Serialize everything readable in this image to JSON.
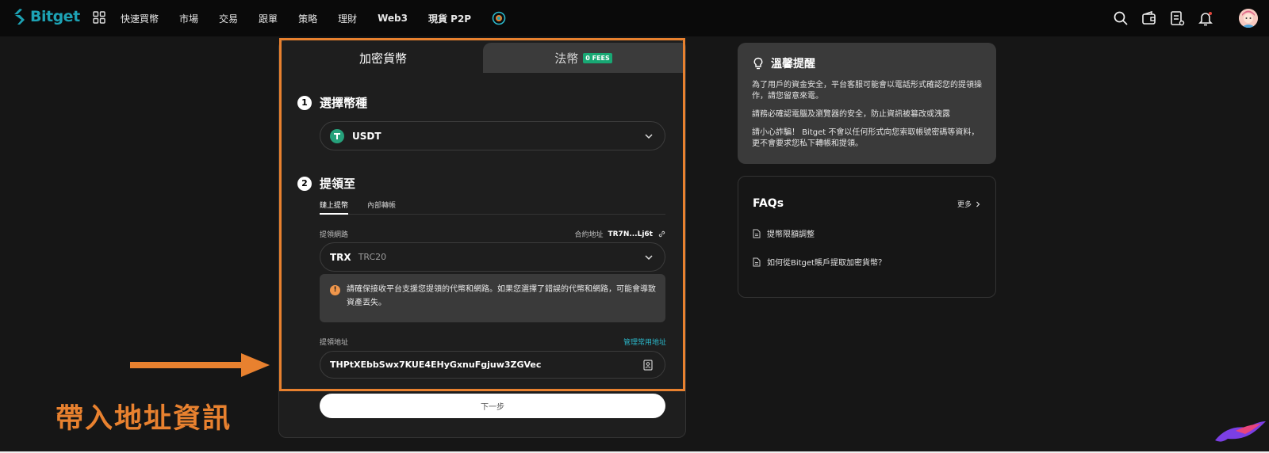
{
  "app": {
    "logo_text": "Bitget"
  },
  "nav": {
    "items": [
      "快速買幣",
      "市場",
      "交易",
      "跟單",
      "策略",
      "理財",
      "Web3",
      "現貨 P2P"
    ]
  },
  "colors": {
    "accent": "#1da2b4",
    "highlight": "#e8812f",
    "usdt": "#26a17b",
    "fees": "#18a874",
    "warning": "#f0964b"
  },
  "withdraw": {
    "tab_crypto": "加密貨幣",
    "tab_fiat": "法幣",
    "fees_badge": "0 FEES",
    "step1": {
      "num": "1",
      "title": "選擇幣種",
      "coin": "USDT",
      "coin_icon": "tether-icon"
    },
    "step2": {
      "num": "2",
      "title": "提領至",
      "subtab_onchain": "鏈上提幣",
      "subtab_internal": "內部轉帳",
      "network_label": "提領網路",
      "contract_label": "合約地址",
      "contract_value": "TR7N...Lj6t",
      "network_value": "TRX",
      "network_sub": "TRC20",
      "warning_text": "請確保接收平台支援您提領的代幣和網路。如果您選擇了錯誤的代幣和網路，可能會導致資產丟失。",
      "address_label": "提領地址",
      "manage_link": "管理常用地址",
      "address_value": "THPtXEbbSwx7KUE4EHyGxnuFgjuw3ZGVec"
    },
    "next_button": "下一步"
  },
  "annotation": {
    "text": "帶入地址資訊"
  },
  "tips": {
    "title": "溫馨提醒",
    "p1": "為了用戶的資金安全，平台客服可能會以電話形式確認您的提領操作，請您留意來電。",
    "p2": "請務必確認電腦及瀏覽器的安全，防止資訊被篡改或洩露",
    "p3": "請小心詐騙！ Bitget 不會以任何形式向您索取帳號密碼等資料，更不會要求您私下轉帳和提領。"
  },
  "faq": {
    "title": "FAQs",
    "more": "更多",
    "items": [
      "提幣限額調整",
      "如何從Bitget賬戶提取加密貨幣？"
    ]
  }
}
